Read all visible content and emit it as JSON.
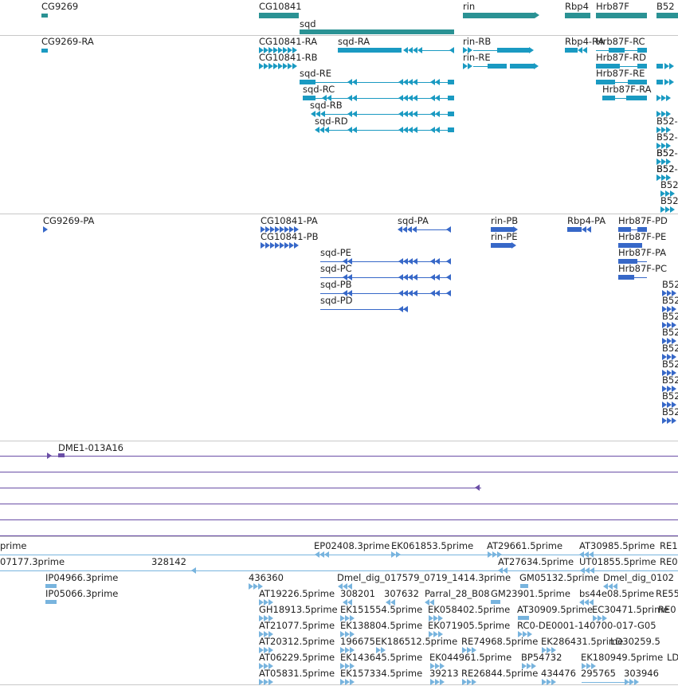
{
  "colors": {
    "gene": "#2a9294",
    "mrna": "#1a9ac2",
    "protein": "#3768c8",
    "clone": "#6a4ea6",
    "est": "#78b4de",
    "separator": "#c8c8c8",
    "text": "#222222"
  },
  "gene_track": {
    "labels": [
      "CG9269",
      "CG10841",
      "sqd",
      "rin",
      "Rbp4",
      "Hrb87F",
      "B52"
    ]
  },
  "mrna_track": {
    "labels": [
      "CG9269-RA",
      "CG10841-RA",
      "sqd-RA",
      "rin-RB",
      "Rbp4-RA",
      "Hrb87F-RC",
      "CG10841-RB",
      "rin-RE",
      "Hrb87F-RD",
      "sqd-RE",
      "Hrb87F-RE",
      "sqd-RC",
      "Hrb87F-RA",
      "sqd-RB",
      "sqd-RD",
      "B52-",
      "B52-",
      "B52-",
      "B52-",
      "B52-",
      "B52-",
      "B52",
      "B52"
    ]
  },
  "protein_track": {
    "labels": [
      "CG9269-PA",
      "CG10841-PA",
      "sqd-PA",
      "rin-PB",
      "Rbp4-PA",
      "Hrb87F-PD",
      "CG10841-PB",
      "rin-PE",
      "Hrb87F-PE",
      "sqd-PE",
      "Hrb87F-PA",
      "sqd-PC",
      "Hrb87F-PC",
      "sqd-PB",
      "sqd-PD",
      "B52",
      "B52",
      "B52",
      "B52",
      "B52",
      "B52",
      "B52",
      "B52",
      "B52"
    ]
  },
  "clone_track": {
    "labels": [
      "DME1-013A16"
    ]
  },
  "est_track": {
    "labels": [
      "prime",
      "EP02408.3prime",
      "EK061853.5prime",
      "AT29661.5prime",
      "AT30985.5prime",
      "RE1",
      "07177.3prime",
      "328142",
      "AT27634.5prime",
      "UT01855.5prime",
      "RE0",
      "IP04966.3prime",
      "436360",
      "Dmel_dig_017579_0719_1414.3prime",
      "GM05132.5prime",
      "Dmel_dig_0102",
      "IP05066.3prime",
      "AT19226.5prime",
      "308201",
      "307632",
      "Parral_28_B08",
      "GM23901.5prime",
      "bs44e08.5prime",
      "RE55",
      "GH18913.5prime",
      "EK151554.5prime",
      "EK058402.5prime",
      "AT30909.5prime",
      "EC30471.5prime",
      "RE0",
      "AT21077.5prime",
      "EK138804.5prime",
      "EK071905.5prime",
      "RC0-DE0001-140700-017-G05",
      "AT20312.5prime",
      "196675",
      "EK186512.5prime",
      "RE74968.5prime",
      "EK286431.5prime",
      "LD30259.5",
      "AT06229.5prime",
      "EK143645.5prime",
      "EK044961.5prime",
      "BP54732",
      "EK180949.5prime",
      "LD",
      "AT05831.5prime",
      "EK157334.5prime",
      "39213",
      "RE26844.5prime",
      "434476",
      "295765",
      "303946"
    ]
  }
}
